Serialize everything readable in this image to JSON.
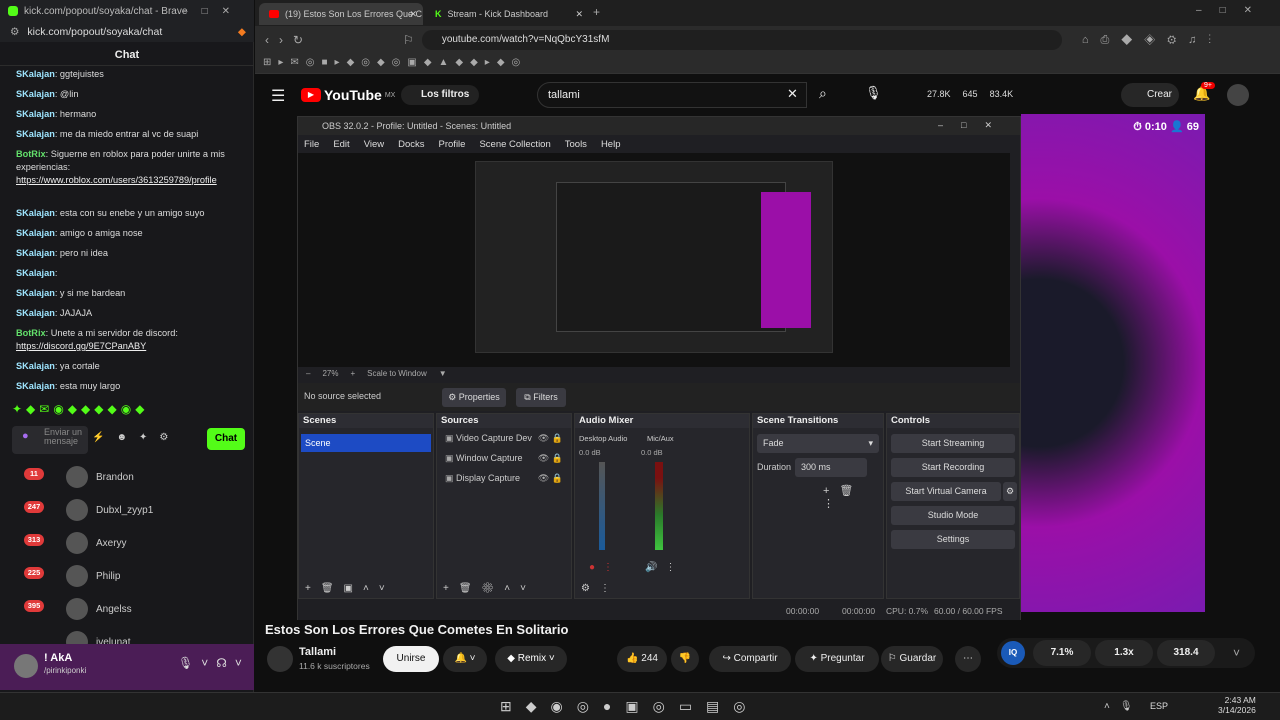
{
  "left": {
    "tab_title": "kick.com/popout/soyaka/chat - Brave",
    "url": "kick.com/popout/soyaka/chat",
    "chat_title": "Chat",
    "messages": [
      {
        "user": "SKalajan",
        "text": "ggtejuistes"
      },
      {
        "user": "SKalajan",
        "text": "@lin"
      },
      {
        "user": "SKalajan",
        "text": "hermano"
      },
      {
        "user": "SKalajan",
        "text": "me da miedo entrar al vc de suapi"
      },
      {
        "user": "BotRix",
        "text": "Siguerne en roblox para poder unirte a mis experiencias:",
        "link": "https://www.roblox.com/users/3613259789/profile"
      },
      {
        "user": "SKalajan",
        "text": "esta con su enebe y un amigo suyo"
      },
      {
        "user": "SKalajan",
        "text": "amigo o amiga nose"
      },
      {
        "user": "SKalajan",
        "text": "pero ni idea"
      },
      {
        "user": "SKalajan",
        "text": ""
      },
      {
        "user": "SKalajan",
        "text": "y si me bardean"
      },
      {
        "user": "SKalajan",
        "text": "JAJAJA"
      },
      {
        "user": "BotRix",
        "text": "Unete a mi servidor de discord:",
        "link": "https://discord.gg/9E7CPanABY"
      },
      {
        "user": "SKalajan",
        "text": "ya cortale"
      },
      {
        "user": "SKalajan",
        "text": "esta muy largo"
      }
    ],
    "input_placeholder": "Enviar un mensaje",
    "chat_button": "Chat",
    "users": [
      {
        "name": "Brandon",
        "badge": "11",
        "extra": "3"
      },
      {
        "name": "Dubxl_zyyp1",
        "badge": "247"
      },
      {
        "name": "Axeryy",
        "badge": "313"
      },
      {
        "name": "Philip",
        "badge": "225"
      },
      {
        "name": "Angelss",
        "badge": "395"
      },
      {
        "name": "jvelunat",
        "badge": ""
      }
    ],
    "voice": {
      "name": "! AkA",
      "sub": "/pirinkiponki"
    }
  },
  "tabs": [
    {
      "title": "(19) Estos Son Los Errores Que C"
    },
    {
      "title": "Stream - Kick Dashboard"
    }
  ],
  "url": "youtube.com/watch?v=NqQbcY31sfM",
  "yt": {
    "logo": "YouTube",
    "region": "MX",
    "filters": "Los filtros",
    "search": "tallami",
    "stats": [
      "27.8K",
      "645",
      "83.4K"
    ],
    "create": "Crear",
    "notif": "9+",
    "timer": "0:10",
    "viewers": "69",
    "video_title": "Estos Son Los Errores Que Cometes En Solitario",
    "channel": "Tallami",
    "subs": "11.6 k suscriptores",
    "join": "Unirse",
    "remix": "Remix",
    "likes": "244",
    "share": "Compartir",
    "ask": "Preguntar",
    "save": "Guardar",
    "ext": [
      "7.1%",
      "1.3x",
      "318.4"
    ]
  },
  "obs": {
    "title": "OBS 32.0.2 - Profile: Untitled - Scenes: Untitled",
    "menu": [
      "File",
      "Edit",
      "View",
      "Docks",
      "Profile",
      "Scene Collection",
      "Tools",
      "Help"
    ],
    "zoom": "27%",
    "scale": "Scale to Window",
    "no_source": "No source selected",
    "properties": "Properties",
    "filters": "Filters",
    "docks": {
      "scenes": "Scenes",
      "sources": "Sources",
      "mixer": "Audio Mixer",
      "transitions": "Scene Transitions",
      "controls": "Controls"
    },
    "scene": "Scene",
    "sources": [
      "Video Capture Dev",
      "Window Capture",
      "Display Capture"
    ],
    "mixer": [
      {
        "name": "Desktop Audio",
        "db": "0.0 dB"
      },
      {
        "name": "Mic/Aux",
        "db": "0.0 dB"
      }
    ],
    "transition": "Fade",
    "duration_label": "Duration",
    "duration": "300 ms",
    "controls": [
      "Start Streaming",
      "Start Recording",
      "Start Virtual Camera",
      "Studio Mode",
      "Settings"
    ],
    "status": {
      "t1": "00:00:00",
      "t2": "00:00:00",
      "cpu": "CPU: 0.7%",
      "fps": "60.00 / 60.00 FPS"
    }
  },
  "taskbar": {
    "lang": "ESP",
    "time": "2:43 AM",
    "date": "3/14/2026"
  }
}
